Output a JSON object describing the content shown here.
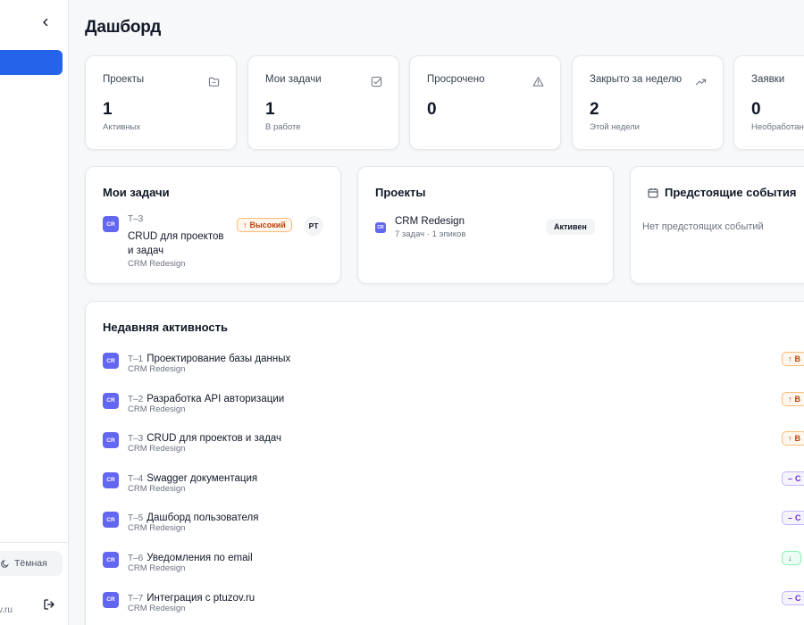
{
  "sidebar": {
    "theme_label": "Тёмная",
    "user_domain": "v.ru"
  },
  "page": {
    "title": "Дашборд"
  },
  "stats": [
    {
      "label": "Проекты",
      "value": "1",
      "sub": "Активных",
      "icon": "folder-icon"
    },
    {
      "label": "Мои задачи",
      "value": "1",
      "sub": "В работе",
      "icon": "checkbox-icon"
    },
    {
      "label": "Просрочено",
      "value": "0",
      "sub": "",
      "icon": "warning-icon"
    },
    {
      "label": "Закрыто за неделю",
      "value": "2",
      "sub": "Этой недели",
      "icon": "trending-up-icon"
    },
    {
      "label": "Заявки",
      "value": "0",
      "sub": "Необработан",
      "icon": ""
    }
  ],
  "my_tasks": {
    "title": "Мои задачи",
    "task": {
      "avatar": "CR",
      "id": "T–3",
      "title": "CRUD для проектов и задач",
      "project": "CRM Redesign",
      "priority": "Высокий",
      "assignee": "PT"
    }
  },
  "projects": {
    "title": "Проекты",
    "item": {
      "avatar": "CR",
      "name": "CRM Redesign",
      "meta": "7 задач · 1 эпиков",
      "status": "Активен"
    }
  },
  "events": {
    "title": "Предстоящие события",
    "empty": "Нет предстоящих событий"
  },
  "activity": {
    "title": "Недавняя активность",
    "items": [
      {
        "avatar": "CR",
        "id": "T–1",
        "title": "Проектирование базы данных",
        "project": "CRM Redesign",
        "badge": "В",
        "badge_kind": "high"
      },
      {
        "avatar": "CR",
        "id": "T–2",
        "title": "Разработка API авторизации",
        "project": "CRM Redesign",
        "badge": "В",
        "badge_kind": "high"
      },
      {
        "avatar": "CR",
        "id": "T–3",
        "title": "CRUD для проектов и задач",
        "project": "CRM Redesign",
        "badge": "В",
        "badge_kind": "high"
      },
      {
        "avatar": "CR",
        "id": "T–4",
        "title": "Swagger документация",
        "project": "CRM Redesign",
        "badge": "С",
        "badge_kind": "medium"
      },
      {
        "avatar": "CR",
        "id": "T–5",
        "title": "Дашборд пользователя",
        "project": "CRM Redesign",
        "badge": "С",
        "badge_kind": "medium"
      },
      {
        "avatar": "CR",
        "id": "T–6",
        "title": "Уведомления по email",
        "project": "CRM Redesign",
        "badge": "",
        "badge_kind": "low"
      },
      {
        "avatar": "CR",
        "id": "T–7",
        "title": "Интеграция с ptuzov.ru",
        "project": "CRM Redesign",
        "badge": "С",
        "badge_kind": "medium"
      }
    ]
  },
  "colors": {
    "accent": "#2563eb",
    "avatar": "#6366f1"
  }
}
